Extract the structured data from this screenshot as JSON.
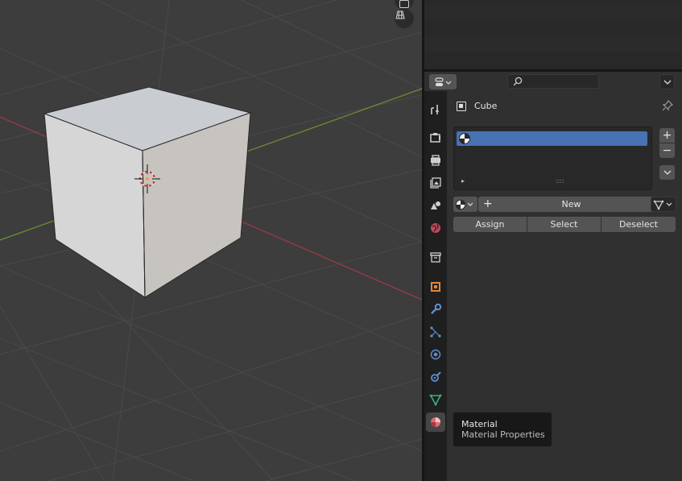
{
  "viewport": {
    "object_name": "Cube",
    "icons": [
      "camera-icon",
      "grid-view-icon"
    ]
  },
  "properties": {
    "header": {
      "editor_type_icon": "properties-editor-icon",
      "search_placeholder": "",
      "options_icon": "chevron-down-icon"
    },
    "tabs": [
      {
        "name": "tool",
        "icon": "tool-icon"
      },
      {
        "name": "render",
        "icon": "render-icon"
      },
      {
        "name": "output",
        "icon": "output-icon"
      },
      {
        "name": "view-layer",
        "icon": "view-layer-icon"
      },
      {
        "name": "scene",
        "icon": "scene-icon"
      },
      {
        "name": "world",
        "icon": "world-icon"
      },
      {
        "name": "collection",
        "icon": "collection-icon"
      },
      {
        "name": "object",
        "icon": "object-icon"
      },
      {
        "name": "modifiers",
        "icon": "wrench-icon"
      },
      {
        "name": "particles",
        "icon": "particles-icon"
      },
      {
        "name": "physics",
        "icon": "physics-icon"
      },
      {
        "name": "constraints",
        "icon": "constraint-icon"
      },
      {
        "name": "data",
        "icon": "mesh-data-icon"
      },
      {
        "name": "material",
        "icon": "material-icon",
        "active": true
      }
    ],
    "object_label": "Cube",
    "slot_add": "+",
    "slot_remove": "−",
    "list_grip": "::::",
    "list_expand": "▸",
    "new_button_plus": "+",
    "new_button_label": "New",
    "assign_label": "Assign",
    "select_label": "Select",
    "deselect_label": "Deselect"
  },
  "tooltip": {
    "title": "Material",
    "description": "Material Properties"
  },
  "colors": {
    "accent_blue": "#4772b3",
    "x_axis": "#9b3a46",
    "y_axis": "#6b8c31",
    "material_icon": "#e06c75"
  }
}
